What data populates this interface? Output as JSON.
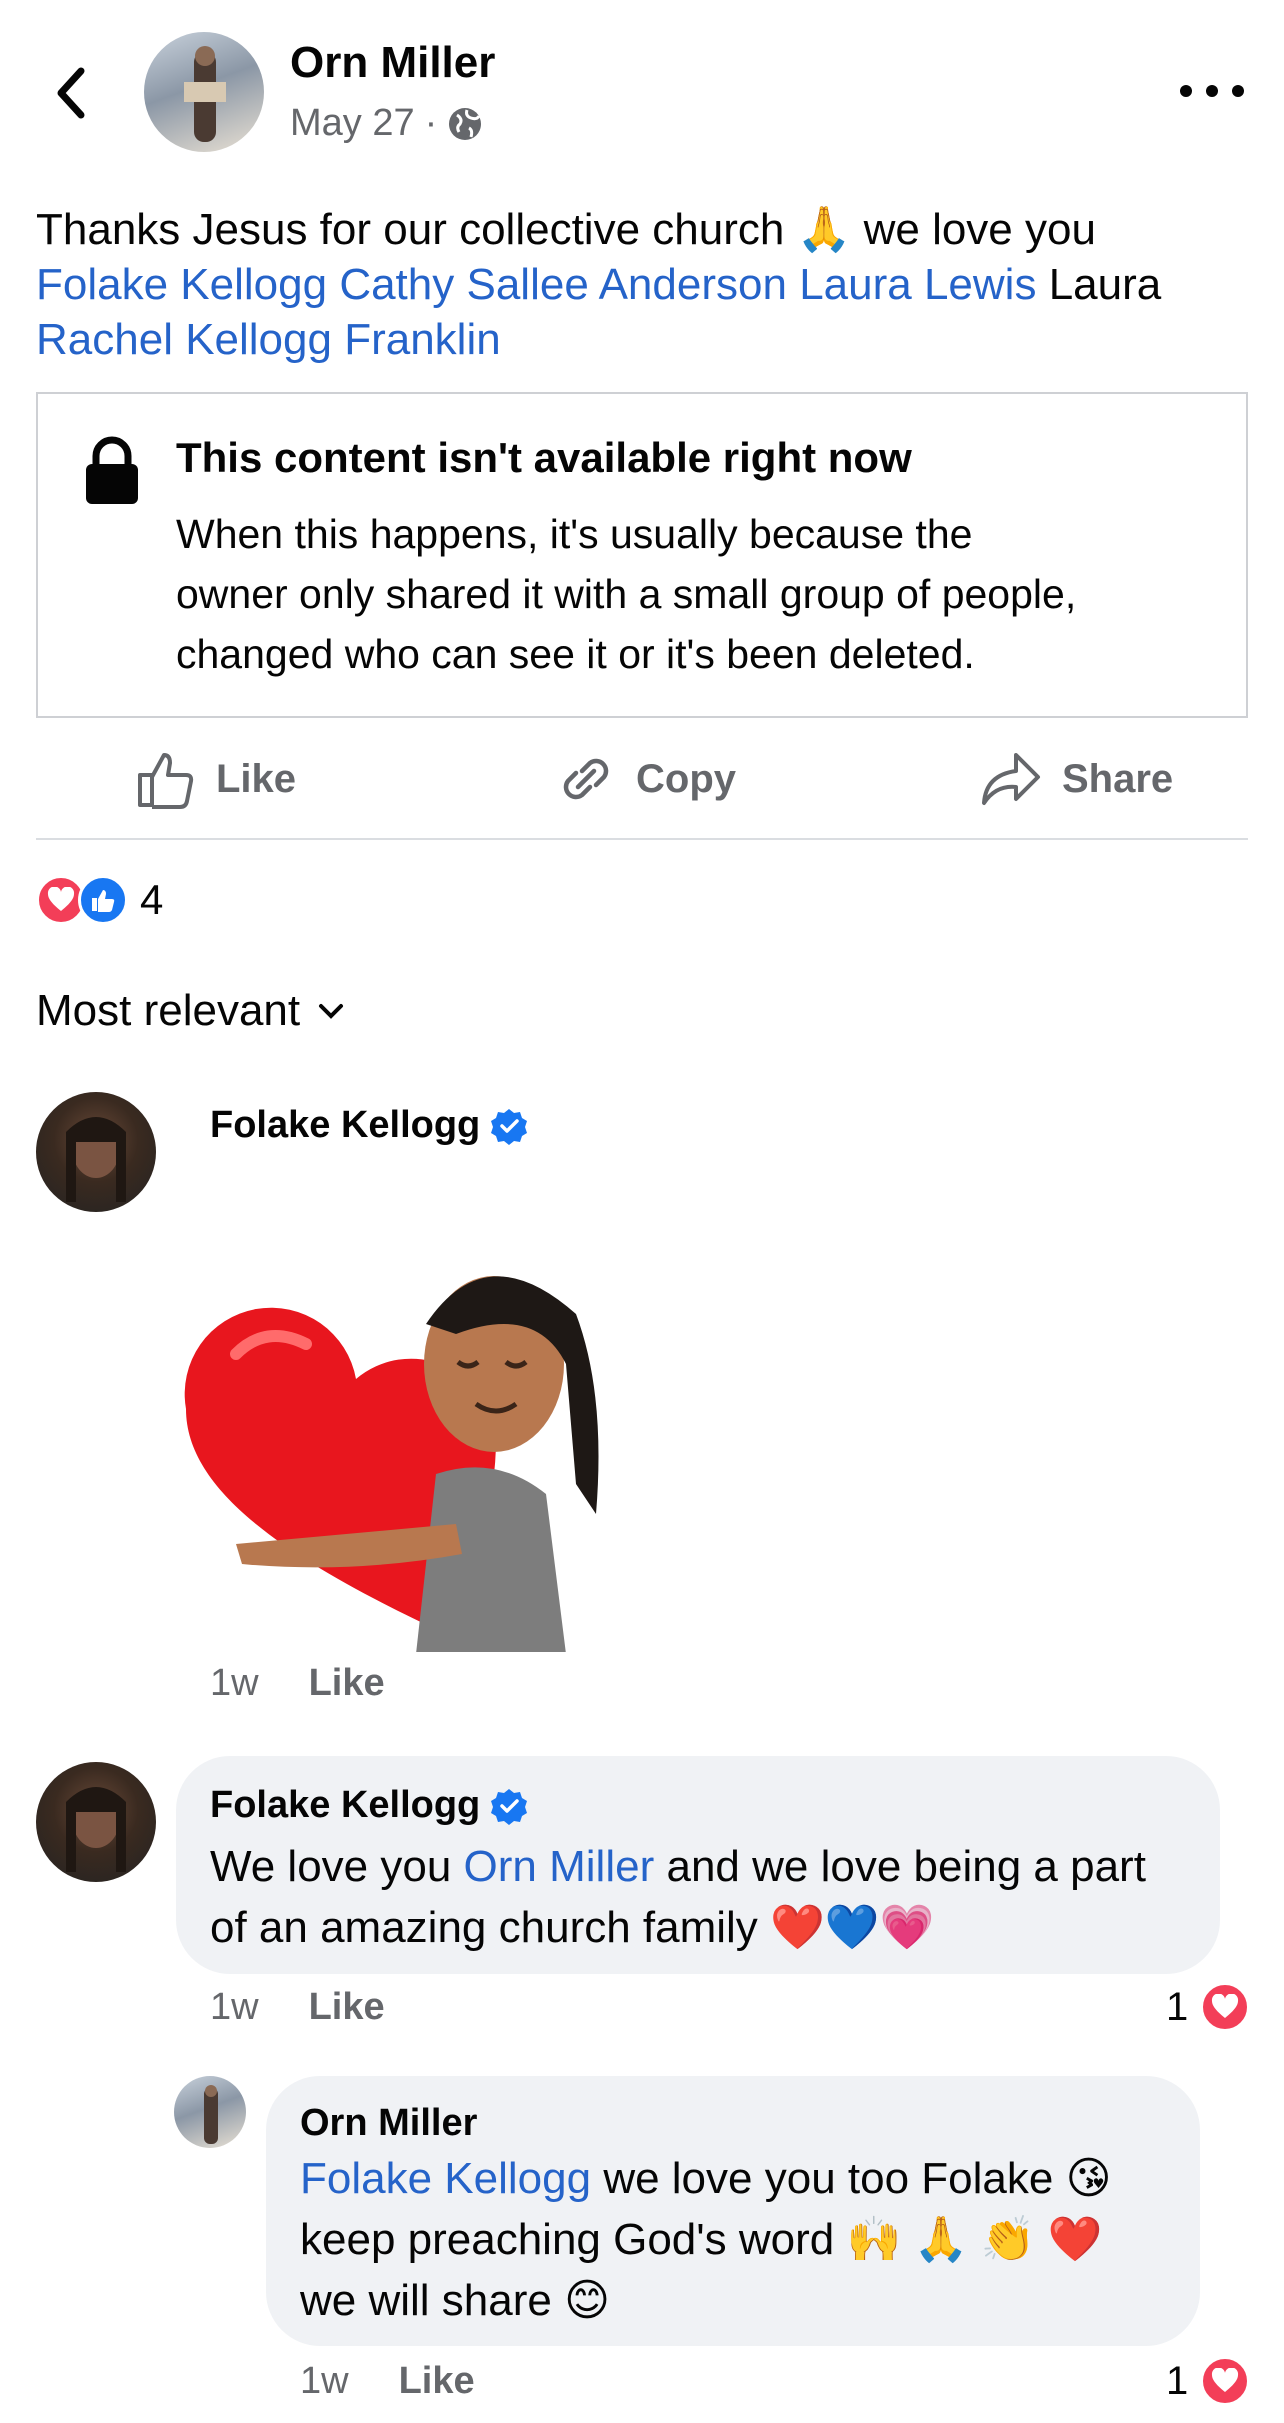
{
  "post": {
    "author": "Orn Miller",
    "date": "May 27",
    "separator": "·",
    "text_line1": "Thanks Jesus for our collective church",
    "text_emoji1": "🙏",
    "text_line1_end": "we love you",
    "tags": [
      "Folake Kellogg",
      "Cathy Sallee Anderson",
      "Laura Lewis"
    ],
    "plain_after_tags": "Laura",
    "tags_line3": "Rachel Kellogg Franklin"
  },
  "unavailable": {
    "title": "This content isn't available right now",
    "line1": "When this happens, it's usually because the",
    "line2": "owner only shared it with a small group of people,",
    "line3": "changed who can see it or it's been deleted."
  },
  "actions": {
    "like": "Like",
    "copy": "Copy",
    "share": "Share"
  },
  "reactions": {
    "count": "4",
    "types": [
      "love",
      "like"
    ]
  },
  "sort": {
    "label": "Most relevant"
  },
  "comments": [
    {
      "author": "Folake Kellogg",
      "verified": true,
      "time": "1w",
      "like_label": "Like"
    },
    {
      "author": "Folake Kellogg",
      "verified": true,
      "text_pre": "We love you",
      "mention": "Orn Miller",
      "text_post": "and we love being a part",
      "text_line2": "of an amazing church family",
      "emojis": "❤️💙💗",
      "time": "1w",
      "like_label": "Like",
      "reaction_count": "1"
    },
    {
      "author": "Orn Miller",
      "mention": "Folake Kellogg",
      "text_post": "we love you too Folake",
      "emoji1": "😘",
      "text_line2": "keep preaching God's word",
      "emoji2": "🙌 🙏 👏 ❤️",
      "text_line3": "we will share",
      "emoji3": "😊",
      "time": "1w",
      "like_label": "Like",
      "reaction_count": "1"
    }
  ],
  "colors": {
    "link": "#2563c9",
    "love": "#f33e58",
    "like": "#1877f2",
    "bubble": "#f0f2f5"
  }
}
